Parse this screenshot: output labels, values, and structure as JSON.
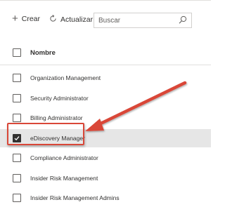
{
  "toolbar": {
    "create_label": "Crear",
    "refresh_label": "Actualizar",
    "search_placeholder": "Buscar",
    "search_value": ""
  },
  "table": {
    "header_name": "Nombre",
    "rows": [
      {
        "name": "Organization Management",
        "checked": false
      },
      {
        "name": "Security Administrator",
        "checked": false
      },
      {
        "name": "Billing Administrator",
        "checked": false
      },
      {
        "name": "eDiscovery Manager",
        "checked": true
      },
      {
        "name": "Compliance Administrator",
        "checked": false
      },
      {
        "name": "Insider Risk Management",
        "checked": false
      },
      {
        "name": "Insider Risk Management Admins",
        "checked": false
      }
    ]
  },
  "annotation": {
    "highlight_color": "#d94738",
    "highlight_target": "eDiscovery Manager"
  }
}
